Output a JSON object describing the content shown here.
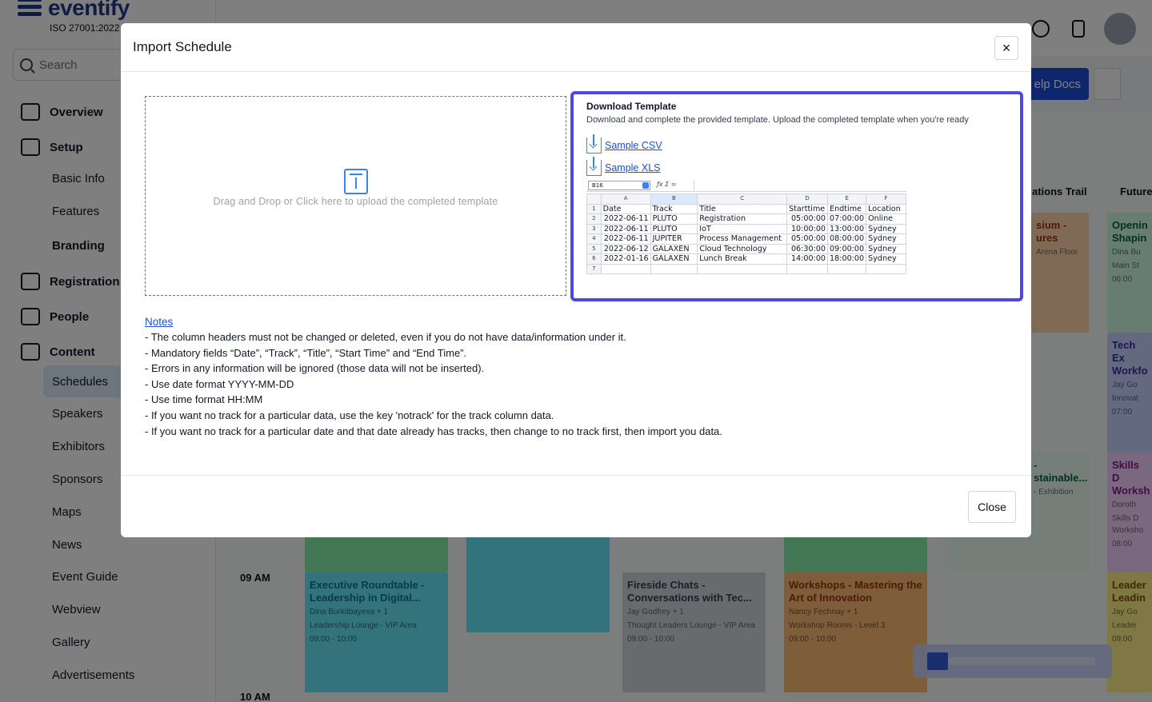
{
  "app": {
    "logo_text": "eventify",
    "iso": "ISO 27001:2022",
    "search_placeholder": "Search",
    "nav": [
      {
        "label": "Overview"
      },
      {
        "label": "Setup"
      },
      {
        "label": "Registration"
      },
      {
        "label": "People"
      },
      {
        "label": "Content"
      }
    ],
    "setup_sub": [
      "Basic Info",
      "Features",
      "Branding"
    ],
    "content_sub": [
      "Schedules",
      "Speakers",
      "Exhibitors",
      "Sponsors",
      "Maps",
      "News",
      "Event Guide",
      "Webview",
      "Gallery",
      "Advertisements"
    ],
    "help_label": "elp Docs",
    "columns": [
      "ations Trail",
      "Future"
    ],
    "times": [
      "09 AM",
      "10 AM"
    ],
    "cards": [
      {
        "title": "Executive Roundtable - Leadership in Digital...",
        "speaker": "Dina Burkitbayeva + 1",
        "location": "Leadership Lounge - VIP Area",
        "time": "09:00 - 10:00",
        "color": "#67e8f9",
        "text_color": "#0e7490"
      },
      {
        "title": "Fireside Chats - Conversations with Tec...",
        "speaker": "Jay Godfrey + 1",
        "location": "Thought Leaders Lounge - VIP Area",
        "time": "09:00 - 10:00",
        "color": "#d1d5db",
        "text_color": "#374151"
      },
      {
        "title": "Workshops - Mastering the Art of Innovation",
        "speaker": "Nancy Fechnay + 1",
        "location": "Workshop Rooms - Level 3",
        "time": "09:00 - 10:00",
        "color": "#fdba74",
        "text_color": "#9a3412"
      },
      {
        "title": "Openin Shapin",
        "speaker": "Dina Bu",
        "location": "Main St",
        "time": "06:00",
        "color": "#d1fae5",
        "text_color": "#065f46"
      },
      {
        "title": "Tech Ex Workfo",
        "speaker": "Jay Go",
        "location": "Innovat",
        "time": "07:00",
        "color": "#c7d2fe",
        "text_color": "#3730a3"
      },
      {
        "title": "Skills D Worksh",
        "speaker": "Doroth",
        "location": "Skills D Worksho",
        "time": "08:00",
        "color": "#f5d0fe",
        "text_color": "#86198f"
      },
      {
        "title": "Leader Leadin",
        "speaker": "Jay Go",
        "location": "Leader",
        "time": "09:00",
        "color": "#fef08a",
        "text_color": "#854d0e"
      },
      {
        "title": "sium - ures",
        "speaker": "",
        "location": "Arena Floor",
        "time": "",
        "color": "#fed7aa",
        "text_color": "#9a3412"
      },
      {
        "title": "- stainable...",
        "speaker": "",
        "location": "- Exhibition",
        "time": "",
        "color": "#ecfdf5",
        "text_color": "#065f46"
      }
    ]
  },
  "modal": {
    "title": "Import Schedule",
    "close_x": "×",
    "dropzone_text": "Drag and Drop or Click here to upload the completed template",
    "template": {
      "title": "Download Template",
      "description": "Download and complete the provided template. Upload the completed template when you're ready",
      "links": [
        "Sample CSV",
        "Sample XLS"
      ]
    },
    "sheet": {
      "cell_ref": "B16",
      "col_letters": [
        "A",
        "B",
        "C",
        "D",
        "E",
        "F"
      ],
      "rows": [
        [
          "Date",
          "Track",
          "Title",
          "Starttime",
          "Endtime",
          "Location"
        ],
        [
          "2022-06-11",
          "PLUTO",
          "Registration",
          "05:00:00",
          "07:00:00",
          "Online"
        ],
        [
          "2022-06-11",
          "PLUTO",
          "IoT",
          "10:00:00",
          "13:00:00",
          "Sydney"
        ],
        [
          "2022-06-11",
          "JUPITER",
          "Process Management",
          "05:00:00",
          "08:00:00",
          "Sydney"
        ],
        [
          "2022-06-12",
          "GALAXEN",
          "Cloud Technology",
          "06:30:00",
          "09:00:00",
          "Sydney"
        ],
        [
          "2022-01-16",
          "GALAXEN",
          "Lunch Break",
          "14:00:00",
          "18:00:00",
          "Sydney"
        ],
        [
          "",
          "",
          "",
          "",
          "",
          ""
        ]
      ]
    },
    "notes_title": "Notes",
    "notes": [
      "- The column headers must not be changed or deleted, even if you do not have data/information under it.",
      "- Mandatory fields “Date”, “Track”, “Title”, “Start Time” and “End Time”.",
      "- Errors in any information will be ignored (those data will not be inserted).",
      "- Use date format YYYY-MM-DD",
      "- Use time format HH:MM",
      "- If you want no track for a particular data, use the key 'notrack' for the track column data.",
      "- If you want no track for a particular date and that date already has tracks, then change to no track first, then import you data."
    ],
    "close_button": "Close"
  }
}
